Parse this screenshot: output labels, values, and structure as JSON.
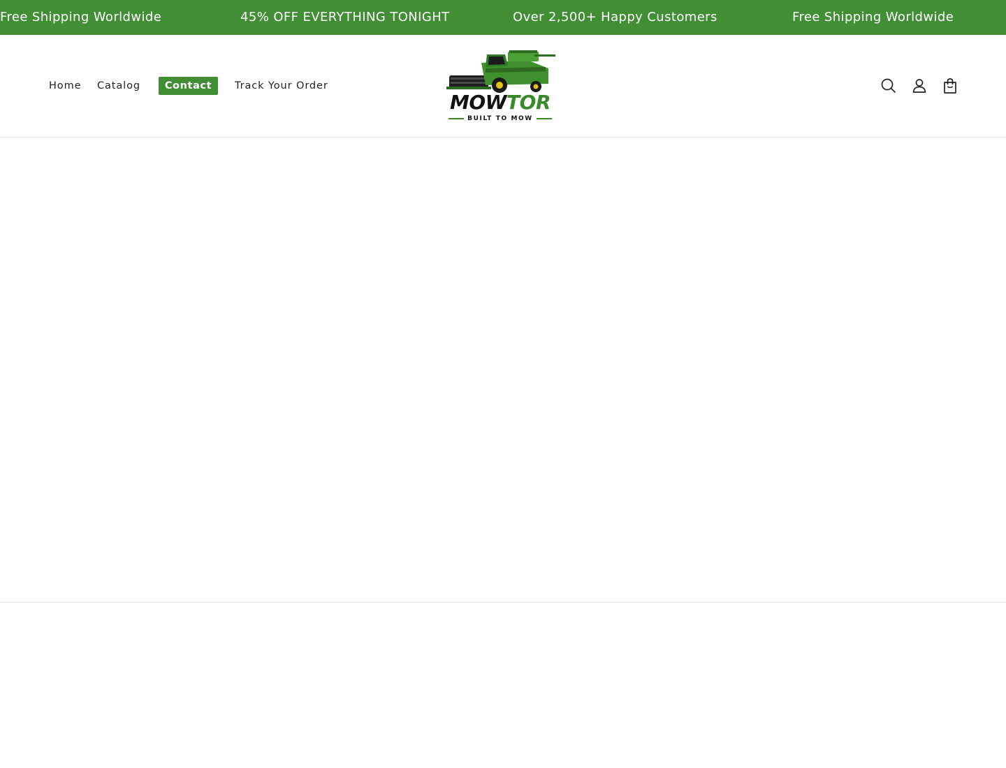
{
  "announcement": {
    "background_color": "#418e35",
    "items": [
      "Free Shipping Worldwide",
      "45% OFF EVERYTHING TONIGHT",
      "Over 2,500+ Happy Customers",
      "Free Shipping Worldwide"
    ]
  },
  "header": {
    "nav": {
      "home": "Home",
      "catalog": "Catalog",
      "contact": "Contact",
      "track": "Track Your Order"
    },
    "active_color": "#418e35",
    "logo": {
      "word_part1": "MOW",
      "word_part2": "TOR",
      "tagline": "BUILT TO MOW",
      "icon": "combine-harvester-icon"
    },
    "icons": {
      "search": "search-icon",
      "account": "account-icon",
      "cart": "cart-icon"
    }
  }
}
